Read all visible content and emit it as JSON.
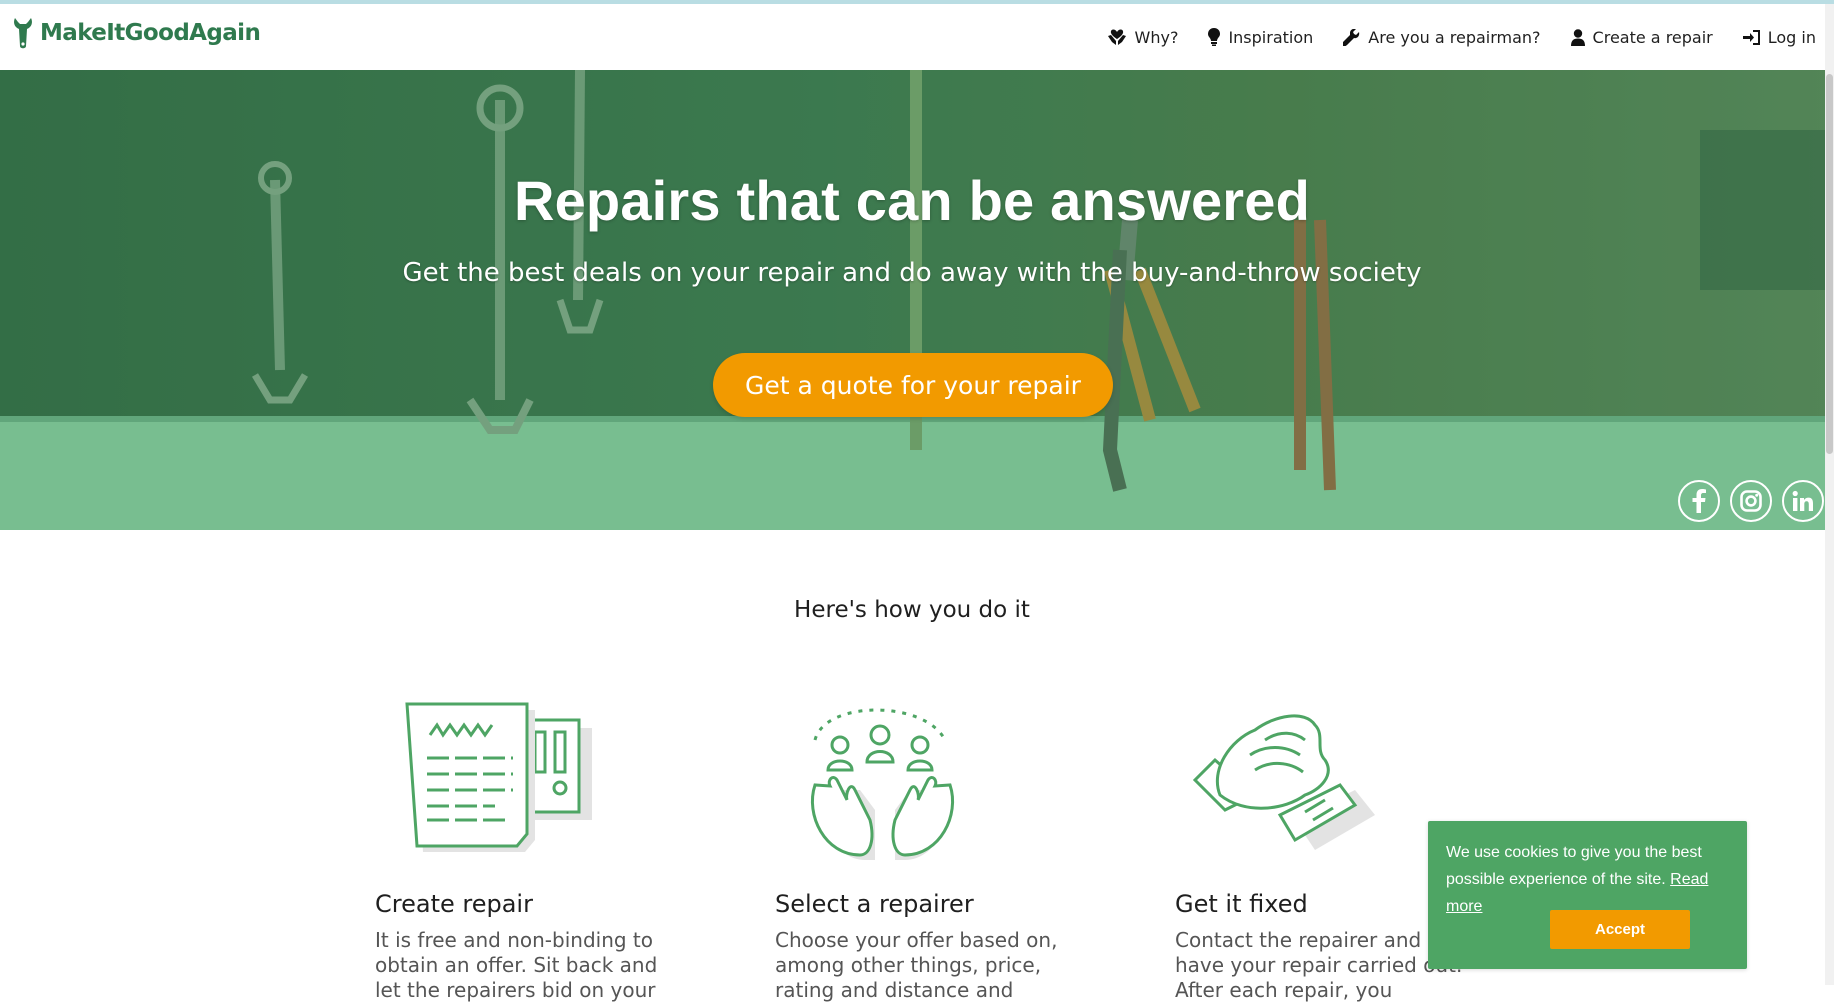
{
  "brand": {
    "name": "MakeItGoodAgain",
    "color": "#2f7a4e"
  },
  "nav": {
    "items": [
      {
        "label": "Why?",
        "icon": "hands-heart-icon"
      },
      {
        "label": "Inspiration",
        "icon": "lightbulb-icon"
      },
      {
        "label": "Are you a repairman?",
        "icon": "wrench-icon"
      },
      {
        "label": "Create a repair",
        "icon": "user-icon"
      },
      {
        "label": "Log in",
        "icon": "sign-in-icon"
      }
    ]
  },
  "hero": {
    "title": "Repairs that can be answered",
    "subtitle": "Get the best deals on your repair and do away with the buy-and-throw society",
    "cta": "Get a quote for your repair",
    "overlay_color": "#3fa060",
    "cta_color": "#f29a00",
    "socials": [
      "facebook-icon",
      "instagram-icon",
      "linkedin-icon"
    ]
  },
  "how": {
    "title": "Here's how you do it",
    "steps": [
      {
        "title": "Create repair",
        "text": "It is free and non-binding to obtain an offer. Sit back and let the repairers bid on your",
        "icon": "document-icon"
      },
      {
        "title": "Select a repairer",
        "text": "Choose your offer based on, among other things, price, rating and distance and",
        "icon": "hands-people-icon"
      },
      {
        "title": "Get it fixed",
        "text": "Contact the repairer and have your repair carried out. After each repair, you",
        "icon": "handshake-icon"
      }
    ]
  },
  "cookie": {
    "text": "We use cookies to give you the best possible experience of the site.",
    "link": "Read more",
    "accept": "Accept",
    "bg_color": "#4ea564"
  }
}
